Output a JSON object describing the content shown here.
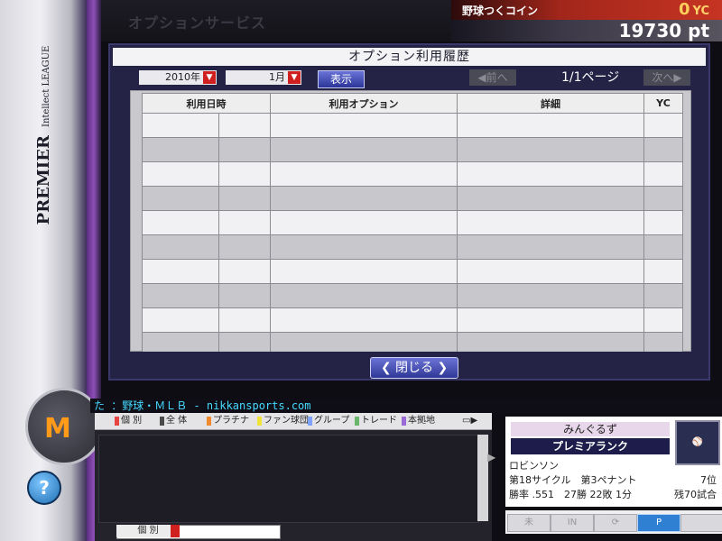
{
  "window": {
    "header_title": "オプションサービス",
    "brand": {
      "league_main": "PREMIER",
      "league_sub": "Intellect LEAGUE"
    }
  },
  "coins": {
    "label": "野球つくコイン",
    "value": "0",
    "unit": "YC",
    "points": "19730 pt"
  },
  "dialog": {
    "title": "オプション利用履歴",
    "year_select": "2010年",
    "month_select": "1月",
    "show_button": "表示",
    "prev_button": "前へ",
    "next_button": "次へ",
    "page_indicator": "1/1ページ",
    "columns": [
      "利用日時",
      "利用オプション",
      "詳細",
      "YC"
    ],
    "close_button": "閉じる"
  },
  "ticker": {
    "text": "た ：野球・ＭＬＢ - nikkansports.com"
  },
  "chat": {
    "tabs": [
      {
        "label": "個 別",
        "color": "#e64343"
      },
      {
        "label": "全 体",
        "color": "#4a4a4a"
      },
      {
        "label": "プラチナ",
        "color": "#f08a2f"
      },
      {
        "label": "ファン球団",
        "color": "#f0e43b"
      },
      {
        "label": "グループ",
        "color": "#7ea3ff"
      },
      {
        "label": "トレード",
        "color": "#6ab66a"
      },
      {
        "label": "本拠地",
        "color": "#9a6ad6"
      }
    ],
    "input_select": "個 別"
  },
  "profile": {
    "team_name": "みんぐるず",
    "rank": "プレミアランク",
    "player": "ロビンソン",
    "cycle": "第18サイクル",
    "pennant": "第3ペナント",
    "position": "7位",
    "win_rate": "勝率 .551",
    "record": "27勝 22敗 1分",
    "remaining": "残70試合"
  },
  "bottom_buttons": [
    {
      "label": "未",
      "active": false
    },
    {
      "label": "IN",
      "active": false
    },
    {
      "label": "⟳",
      "active": false
    },
    {
      "label": "P",
      "active": true
    },
    {
      "label": "",
      "active": false
    }
  ],
  "colors": {
    "dialog_bg": "#242245",
    "button_blue": "#2f3796",
    "coin_red": "#c63422"
  }
}
